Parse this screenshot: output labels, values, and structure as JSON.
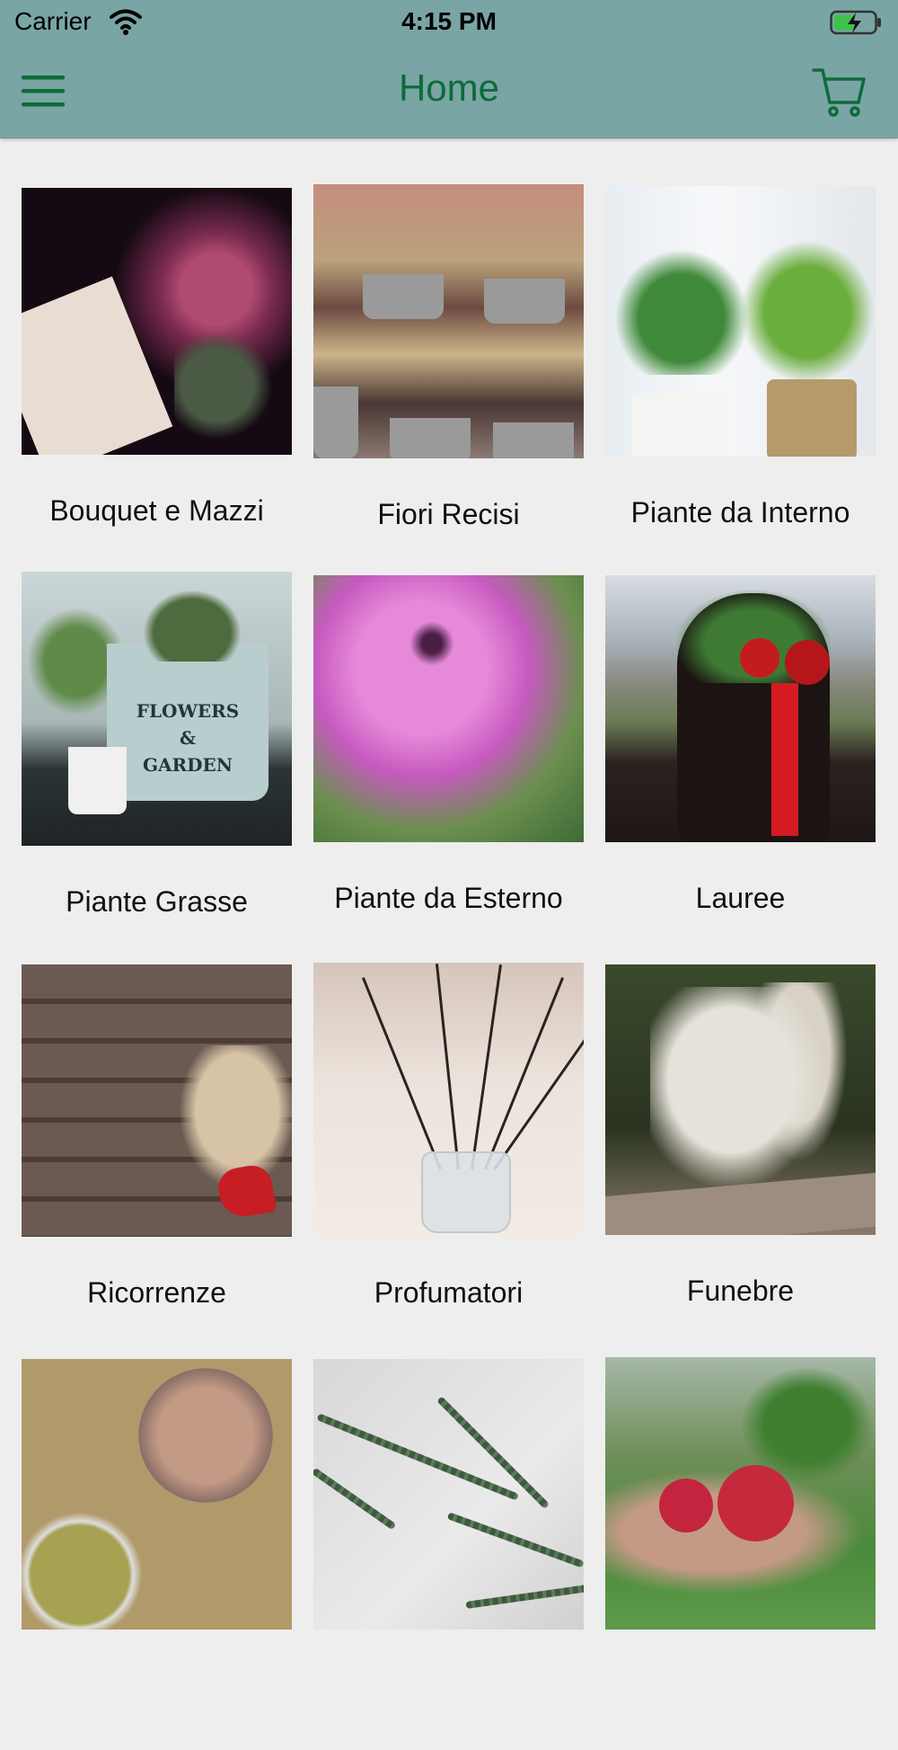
{
  "status_bar": {
    "carrier": "Carrier",
    "time": "4:15 PM",
    "icons": [
      "wifi-icon",
      "battery-charging-icon"
    ]
  },
  "navbar": {
    "title": "Home",
    "left_icon": "hamburger-menu-icon",
    "right_icon": "shopping-cart-icon",
    "background_color": "#7aa5a5",
    "title_color": "#0f6b3a"
  },
  "categories": [
    {
      "label": "Bouquet e Mazzi"
    },
    {
      "label": "Fiori Recisi"
    },
    {
      "label": "Piante da Interno"
    },
    {
      "label": "Piante Grasse"
    },
    {
      "label": "Piante da Esterno"
    },
    {
      "label": "Lauree"
    },
    {
      "label": "Ricorrenze"
    },
    {
      "label": "Profumatori"
    },
    {
      "label": "Funebre"
    },
    {
      "label": ""
    },
    {
      "label": ""
    },
    {
      "label": ""
    }
  ],
  "images": {
    "grasse_text": [
      "FLOWERS",
      "&",
      "GARDEN"
    ]
  }
}
